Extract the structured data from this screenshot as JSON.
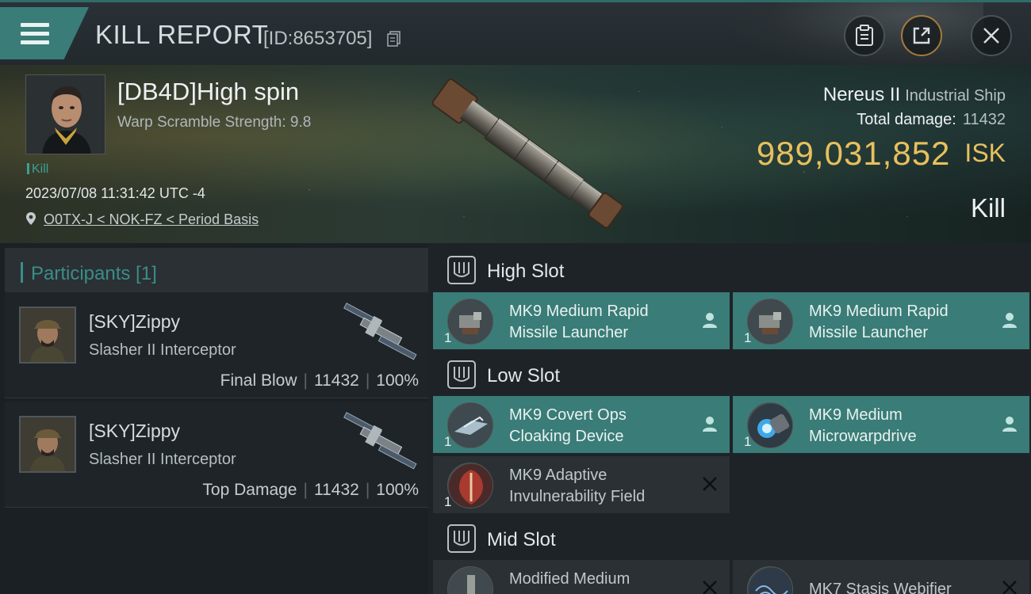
{
  "header": {
    "title": "KILL REPORT",
    "report_id": "[ID:8653705]"
  },
  "victim": {
    "name": "[DB4D]High spin",
    "warp_scramble": "Warp Scramble Strength: 9.8",
    "kill_tag": "Kill",
    "timestamp": "2023/07/08 11:31:42 UTC -4",
    "location": "O0TX-J < NOK-FZ < Period Basis",
    "ship_name": "Nereus II",
    "ship_class": "Industrial Ship",
    "total_damage_label": "Total damage:",
    "total_damage": "11432",
    "isk_value": "989,031,852",
    "isk_unit": "ISK",
    "result_label": "Kill"
  },
  "participants": {
    "header": "Participants [1]",
    "rows": [
      {
        "name": "[SKY]Zippy",
        "ship": "Slasher II Interceptor",
        "role": "Final Blow",
        "damage": "11432",
        "percent": "100%"
      },
      {
        "name": "[SKY]Zippy",
        "ship": "Slasher II Interceptor",
        "role": "Top Damage",
        "damage": "11432",
        "percent": "100%"
      }
    ]
  },
  "slots": {
    "high": {
      "title": "High Slot",
      "modules": [
        {
          "qty": "1",
          "line1": "MK9 Medium Rapid",
          "line2": "Missile Launcher",
          "state": "fitted"
        },
        {
          "qty": "1",
          "line1": "MK9 Medium Rapid",
          "line2": "Missile Launcher",
          "state": "fitted"
        }
      ]
    },
    "low": {
      "title": "Low Slot",
      "modules": [
        {
          "qty": "1",
          "line1": "MK9 Covert Ops",
          "line2": "Cloaking Device",
          "state": "fitted"
        },
        {
          "qty": "1",
          "line1": "MK9 Medium",
          "line2": "Microwarpdrive",
          "state": "fitted"
        },
        {
          "qty": "1",
          "line1": "MK9 Adaptive",
          "line2": "Invulnerability Field",
          "state": "destroyed"
        }
      ]
    },
    "mid": {
      "title": "Mid Slot",
      "modules": [
        {
          "qty": "",
          "line1": "Modified Medium",
          "line2": "",
          "state": "destroyed"
        },
        {
          "qty": "",
          "line1": "MK7 Stasis Webifier",
          "line2": "",
          "state": "destroyed"
        }
      ]
    }
  },
  "colors": {
    "accent_teal": "#3a7c77",
    "isk_gold": "#e8c05e",
    "kill_tag": "#3d9f96"
  }
}
